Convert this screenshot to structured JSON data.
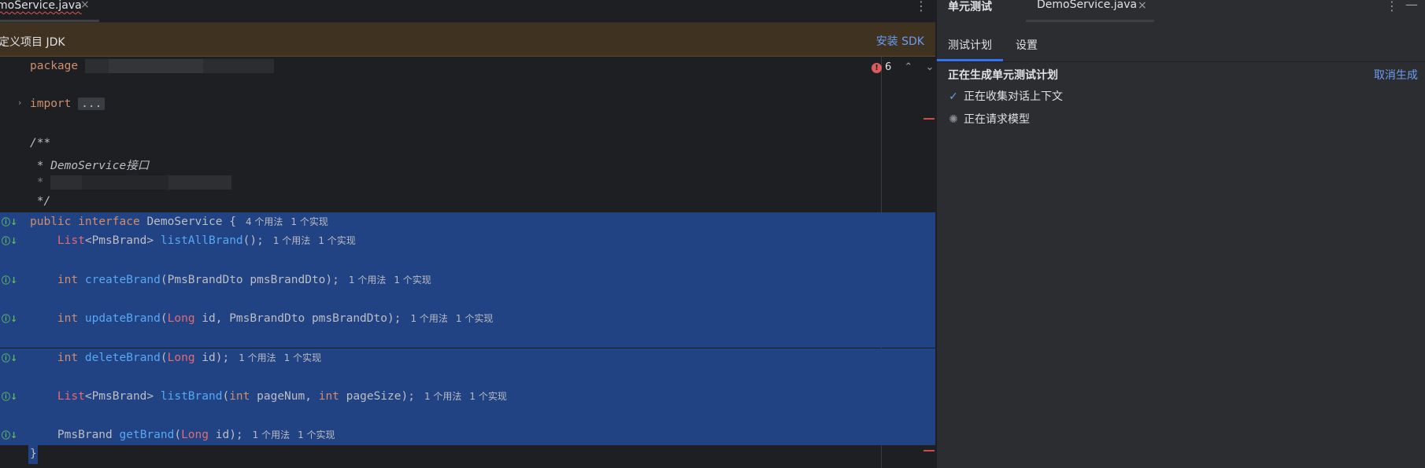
{
  "editor": {
    "tab_label": "moService.java",
    "tab_close": "×",
    "kebab": "⋮",
    "banner": {
      "message": "定义项目 JDK",
      "action": "安装 SDK"
    },
    "error_count": "6",
    "lines": {
      "package_kw": "package",
      "import_kw": "import",
      "import_fold": "...",
      "doc_open": "/**",
      "doc_desc": " * DemoService接口",
      "doc_star": " * ",
      "doc_close": " */",
      "decl_public": "public",
      "decl_interface": "interface",
      "decl_name": "DemoService",
      "decl_brace": " {",
      "decl_usages": "4 个用法",
      "decl_impls": "1 个实现",
      "m1_type": "List",
      "m1_generic": "<PmsBrand>",
      "m1_name": "listAllBrand",
      "m1_rest": "();",
      "m1_usages": "1 个用法",
      "m1_impls": "1 个实现",
      "m2_type": "int",
      "m2_name": "createBrand",
      "m2_rest": "(PmsBrandDto pmsBrandDto);",
      "m2_usages": "1 个用法",
      "m2_impls": "1 个实现",
      "m3_type": "int",
      "m3_name": "updateBrand",
      "m3_open": "(",
      "m3_long": "Long",
      "m3_rest": " id, PmsBrandDto pmsBrandDto);",
      "m3_usages": "1 个用法",
      "m3_impls": "1 个实现",
      "m4_type": "int",
      "m4_name": "deleteBrand",
      "m4_open": "(",
      "m4_long": "Long",
      "m4_rest": " id);",
      "m4_usages": "1 个用法",
      "m4_impls": "1 个实现",
      "m5_type": "List",
      "m5_generic": "<PmsBrand>",
      "m5_name": "listBrand",
      "m5_open": "(",
      "m5_int1": "int",
      "m5_mid": " pageNum, ",
      "m5_int2": "int",
      "m5_rest": " pageSize);",
      "m5_usages": "1 个用法",
      "m5_impls": "1 个实现",
      "m6_type": "PmsBrand",
      "m6_name": "getBrand",
      "m6_open": "(",
      "m6_long": "Long",
      "m6_rest": " id);",
      "m6_usages": "1 个用法",
      "m6_impls": "1 个实现",
      "close_brace": "}"
    }
  },
  "tool_window": {
    "title": "单元测试",
    "file_tab": "DemoService.java",
    "file_close": "×",
    "kebab": "⋮",
    "minimize": "—",
    "tabs": [
      "测试计划",
      "设置"
    ],
    "status_title": "正在生成单元测试计划",
    "cancel": "取消生成",
    "steps": [
      {
        "label": "正在收集对话上下文",
        "icon": "check-icon"
      },
      {
        "label": "正在请求模型",
        "icon": "spinner-icon"
      }
    ]
  },
  "colors": {
    "selection": "#214283",
    "keyword": "#cf8e6d",
    "type": "#e06c75",
    "method": "#56a8f5",
    "link": "#6b9cf2",
    "banner_bg": "#3f3221",
    "error": "#db5c5c"
  }
}
